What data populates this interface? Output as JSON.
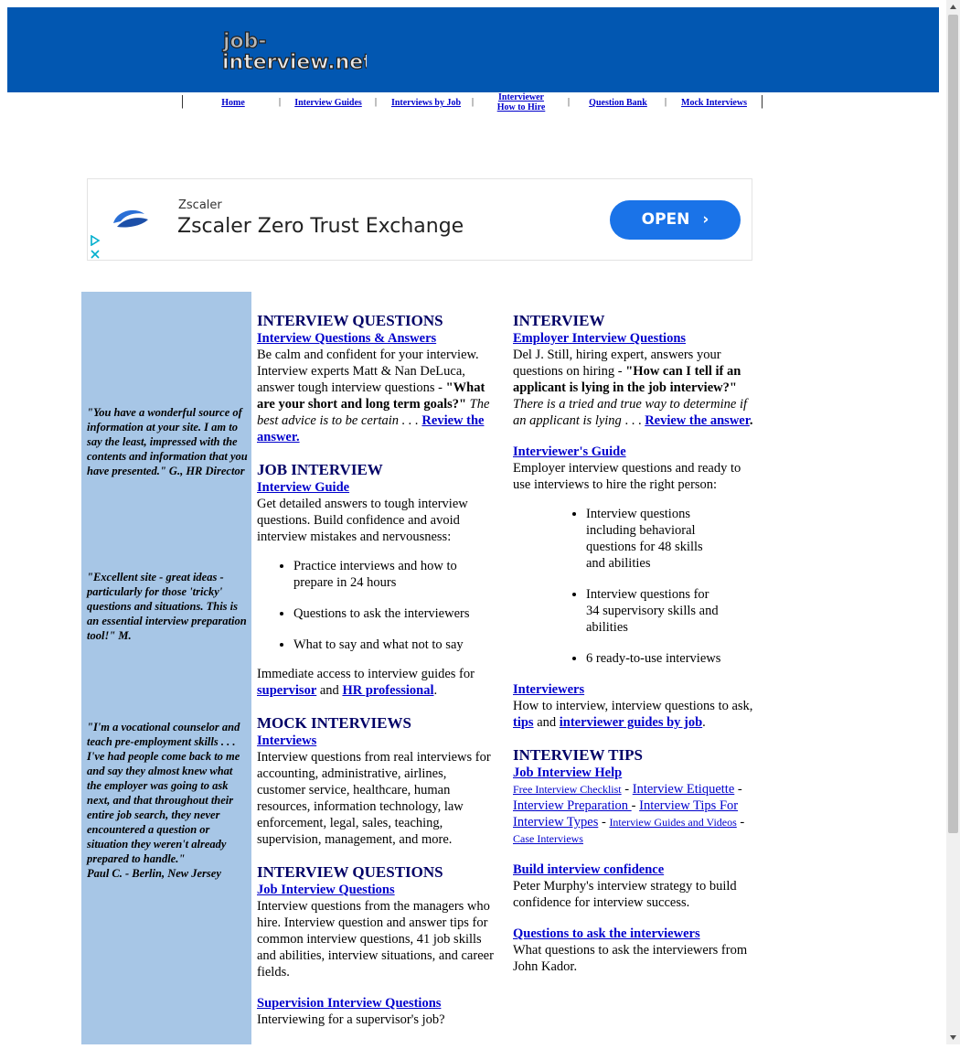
{
  "header": {
    "logo_text": "job-interview.net"
  },
  "nav": {
    "items": [
      {
        "label": "Home"
      },
      {
        "label": "Interview Guides"
      },
      {
        "label": "Interviews by Job"
      },
      {
        "label_line1": "Interviewer",
        "label_line2": "How to Hire"
      },
      {
        "label": "Question Bank"
      },
      {
        "label": "Mock Interviews"
      }
    ],
    "separator": "|"
  },
  "ad": {
    "brand": "Zscaler",
    "headline": "Zscaler Zero Trust Exchange",
    "cta": "OPEN",
    "accent_color": "#1a73e8"
  },
  "testimonials": [
    {
      "text": "\"You have a wonderful source of information at your site.  I am to say the least, impressed with the contents and information that you have presented.\"",
      "author": "G., HR Director"
    },
    {
      "text": "\"Excellent site - great ideas - particularly for those 'tricky' questions and situations. This is an essential interview preparation tool!\"",
      "author": "M."
    },
    {
      "text": "\"I'm a vocational counselor and teach pre-employment skills . . . I've had people come back to me and say they almost knew what the employer was going to ask next, and that throughout their entire job search, they never encountered a question or situation they weren't already prepared to handle.\"",
      "author": "Paul C. - Berlin, New Jersey"
    }
  ],
  "middle": {
    "s1": {
      "heading": "INTERVIEW QUESTIONS",
      "link": "Interview Questions & Answers",
      "text": "Be calm and confident for your interview. Interview experts Matt & Nan DeLuca, answer tough interview questions - ",
      "bold": "\"What are your short and long term goals?\"",
      "italic": " The best advice is to be certain . . . ",
      "more": "Review the answer."
    },
    "s2": {
      "heading": "JOB INTERVIEW",
      "link": "Interview Guide",
      "text": "Get detailed answers to tough interview questions.  Build confidence and avoid interview mistakes and nervousness:",
      "bullets": [
        "Practice interviews and how to prepare in 24 hours",
        "Questions to ask the interviewers",
        "What to say and what not to say"
      ],
      "after": "Immediate access to interview guides for ",
      "link2": "supervisor",
      "and": " and ",
      "link3": "HR professional",
      "end": "."
    },
    "s3": {
      "heading": "MOCK INTERVIEWS",
      "link": "Interviews",
      "text": "Interview questions from real interviews for accounting, administrative, airlines, customer service, healthcare, human resources, information technology, law enforcement, legal, sales, teaching, supervision,  management, and more."
    },
    "s4": {
      "heading": "INTERVIEW QUESTIONS",
      "link": "Job Interview Questions",
      "text": "Interview questions from the managers who hire.  Interview question and answer tips for common interview questions, 41 job skills and abilities, interview situations, and career fields."
    },
    "s5": {
      "link": "Supervision Interview Questions",
      "text": "Interviewing for a supervisor's job?"
    }
  },
  "right": {
    "s1": {
      "heading": "INTERVIEW",
      "link": "Employer Interview Questions",
      "text": "Del J. Still, hiring expert, answers your questions on hiring - ",
      "bold": "\"How can I tell if an applicant is lying in the job interview?\"",
      "italic": "  There is a tried and true way to determine if an applicant is lying",
      "dots": " . . . ",
      "more": "Review the answer",
      "end": "."
    },
    "s2": {
      "link": "Interviewer's Guide",
      "text": "Employer interview questions and ready to use interviews to hire the right person:",
      "bullets": [
        "Interview questions including behavioral questions for 48 skills and abilities",
        "Interview questions for 34 supervisory skills and abilities",
        "6 ready-to-use interviews"
      ]
    },
    "s3": {
      "link": "Interviewers ",
      "text": "How to interview, interview questions to ask, ",
      "link2": "tips",
      "and": " and ",
      "link3": "interviewer guides by job",
      "end": "."
    },
    "s4": {
      "heading": "INTERVIEW TIPS",
      "link": "Job Interview Help",
      "links": [
        "Free Interview Checklist",
        "Interview Etiquette",
        "Interview Preparation ",
        "Interview Tips For Interview Types",
        "Interview Guides and Videos",
        "Case Interviews"
      ],
      "sep": " - "
    },
    "s5": {
      "link": "Build interview confidence",
      "text": "Peter Murphy's interview strategy to build confidence for interview success."
    },
    "s6": {
      "link": "Questions to ask the interviewers",
      "text": "What questions to ask the interviewers from John Kador."
    }
  },
  "colors": {
    "banner": "#0257b1",
    "sidebar": "#a7c6e6",
    "heading": "#000066",
    "link": "#0000cc"
  }
}
